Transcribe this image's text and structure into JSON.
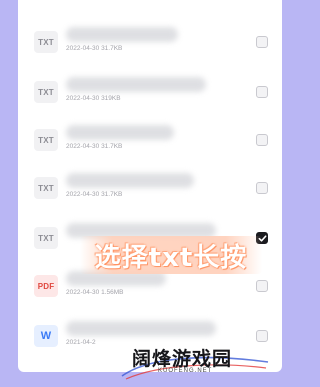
{
  "files": [
    {
      "type": "TXT",
      "date": "2022-04-30",
      "size": "31.7KB",
      "checked": false
    },
    {
      "type": "TXT",
      "date": "2022-04-30",
      "size": "319KB",
      "checked": false
    },
    {
      "type": "TXT",
      "date": "2022-04-30",
      "size": "31.7KB",
      "checked": false
    },
    {
      "type": "TXT",
      "date": "2022-04-30",
      "size": "31.7KB",
      "checked": false
    },
    {
      "type": "TXT",
      "date": "",
      "size": "",
      "checked": true
    },
    {
      "type": "PDF",
      "date": "2022-04-30",
      "size": "1.56MB",
      "checked": false
    },
    {
      "type": "W",
      "date": "2021-04-2",
      "size": "",
      "checked": false
    }
  ],
  "caption": {
    "text": "选择txt长按"
  },
  "watermark": {
    "title": "阔烽游戏园",
    "subtitle": "KUOFENG.NET"
  },
  "colors": {
    "background": "#b9b6f4",
    "accent_caption": "#ffd0ba",
    "checkbox_checked": "#1b1b1f",
    "pdf": "#e0483f",
    "word": "#3b7bf6"
  }
}
